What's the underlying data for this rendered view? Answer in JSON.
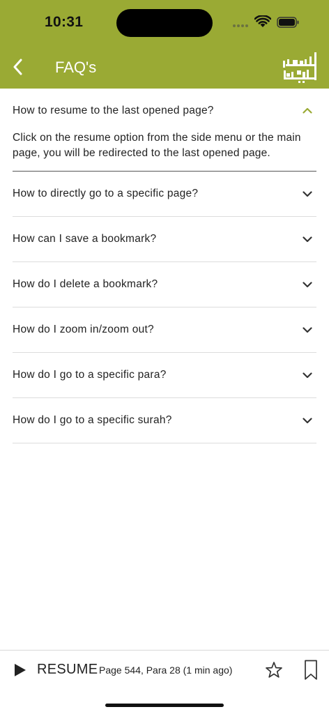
{
  "status_bar": {
    "time": "10:31"
  },
  "header": {
    "title": "FAQ's",
    "back_icon": "chevron-left-icon",
    "logo_text": "القرآن الكريم"
  },
  "colors": {
    "header_bg": "#9aaa34",
    "accent": "#9aaa34"
  },
  "faqs": [
    {
      "question": "How to resume to the last opened page?",
      "answer": "Click on the resume option from the side menu or the main page, you will be redirected to the last opened page.",
      "expanded": true
    },
    {
      "question": "How to directly go to a specific page?",
      "expanded": false
    },
    {
      "question": "How can I save a bookmark?",
      "expanded": false
    },
    {
      "question": "How do I delete a bookmark?",
      "expanded": false
    },
    {
      "question": "How do I zoom in/zoom out?",
      "expanded": false
    },
    {
      "question": "How do I go to a specific para?",
      "expanded": false
    },
    {
      "question": "How do I go to a specific surah?",
      "expanded": false
    }
  ],
  "bottom_bar": {
    "play_icon": "play-icon",
    "resume_label": "RESUME",
    "resume_info": "Page 544, Para 28 (1 min ago)",
    "star_icon": "star-icon",
    "bookmark_icon": "bookmark-icon"
  }
}
